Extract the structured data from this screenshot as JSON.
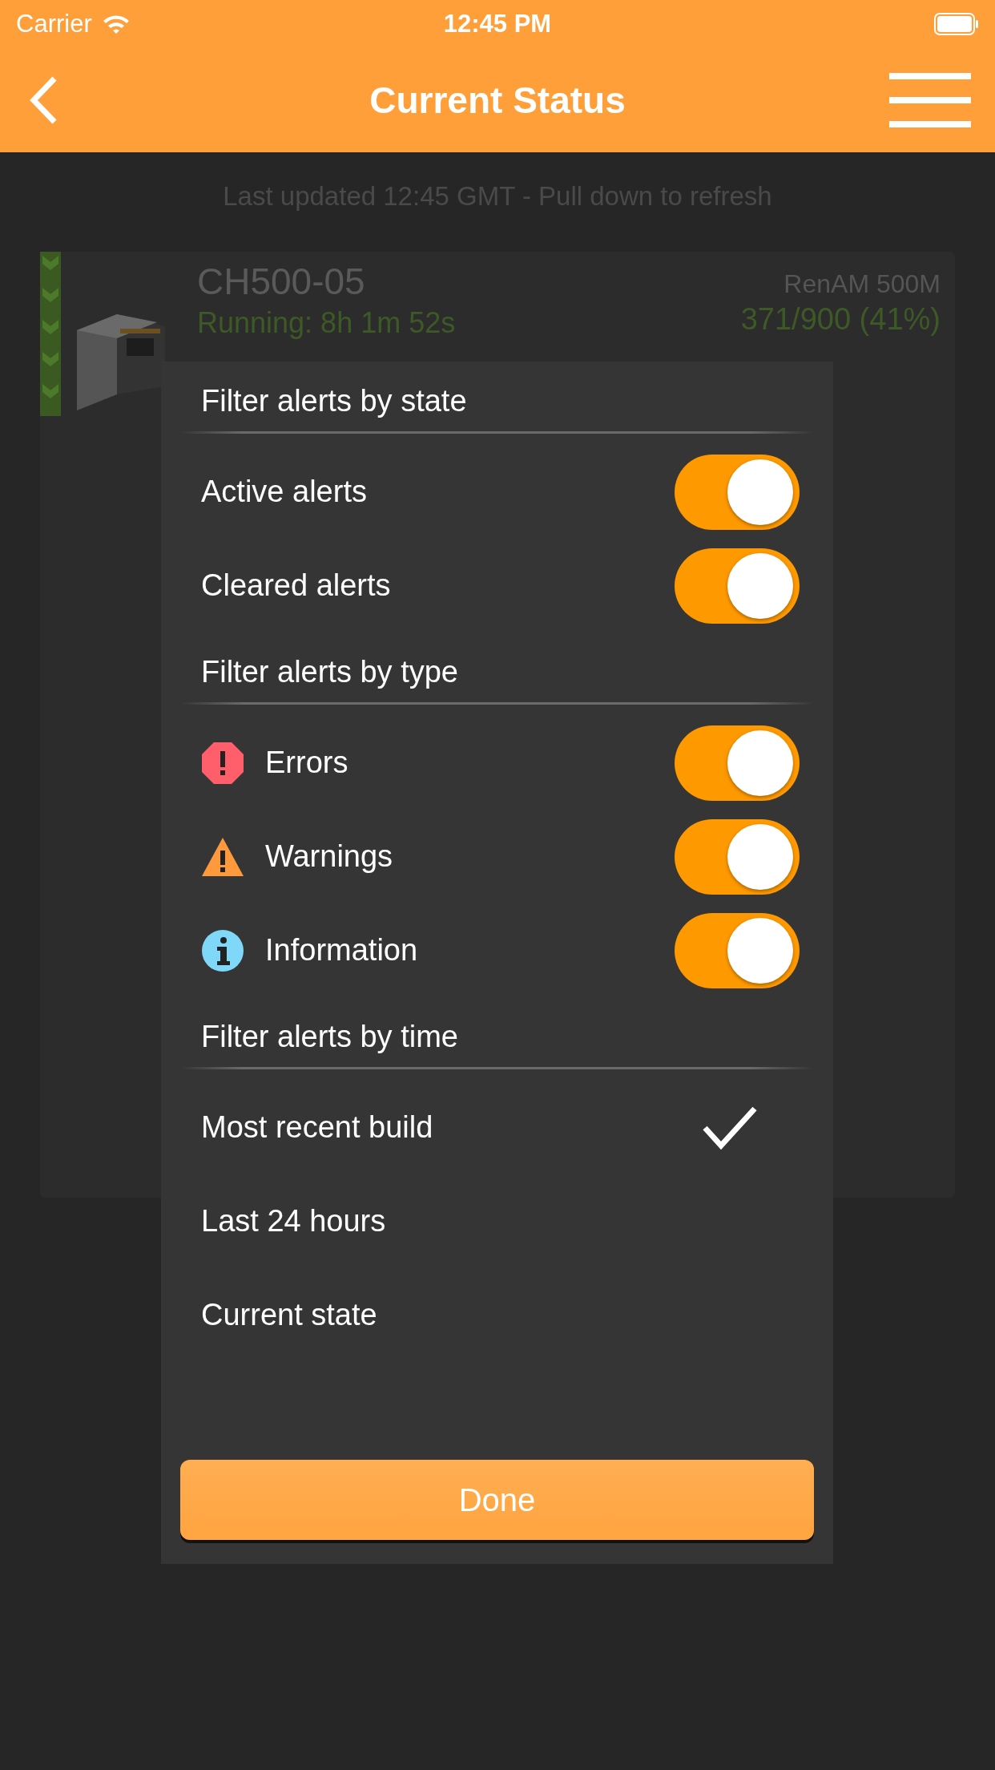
{
  "status_bar": {
    "carrier": "Carrier",
    "time": "12:45 PM"
  },
  "nav_bar": {
    "title": "Current Status"
  },
  "last_updated": "Last updated 12:45 GMT - Pull down to refresh",
  "machine_card": {
    "name": "CH500-05",
    "model": "RenAM 500M",
    "status": "Running: 8h 1m 52s",
    "progress": "371/900 (41%)"
  },
  "filter_dialog": {
    "sections": [
      {
        "title": "Filter alerts by state",
        "items": [
          {
            "kind": "toggle",
            "label": "Active alerts",
            "on": true
          },
          {
            "kind": "toggle",
            "label": "Cleared alerts",
            "on": true
          }
        ]
      },
      {
        "title": "Filter alerts by type",
        "items": [
          {
            "kind": "error",
            "label": "Errors",
            "on": true
          },
          {
            "kind": "warning",
            "label": "Warnings",
            "on": true
          },
          {
            "kind": "info",
            "label": "Information",
            "on": true
          }
        ]
      },
      {
        "title": "Filter alerts by time",
        "items": [
          {
            "kind": "option",
            "label": "Most recent build",
            "selected": true
          },
          {
            "kind": "option",
            "label": "Last 24 hours",
            "selected": false
          },
          {
            "kind": "option",
            "label": "Current state",
            "selected": false
          }
        ]
      }
    ],
    "done_button": "Done"
  }
}
